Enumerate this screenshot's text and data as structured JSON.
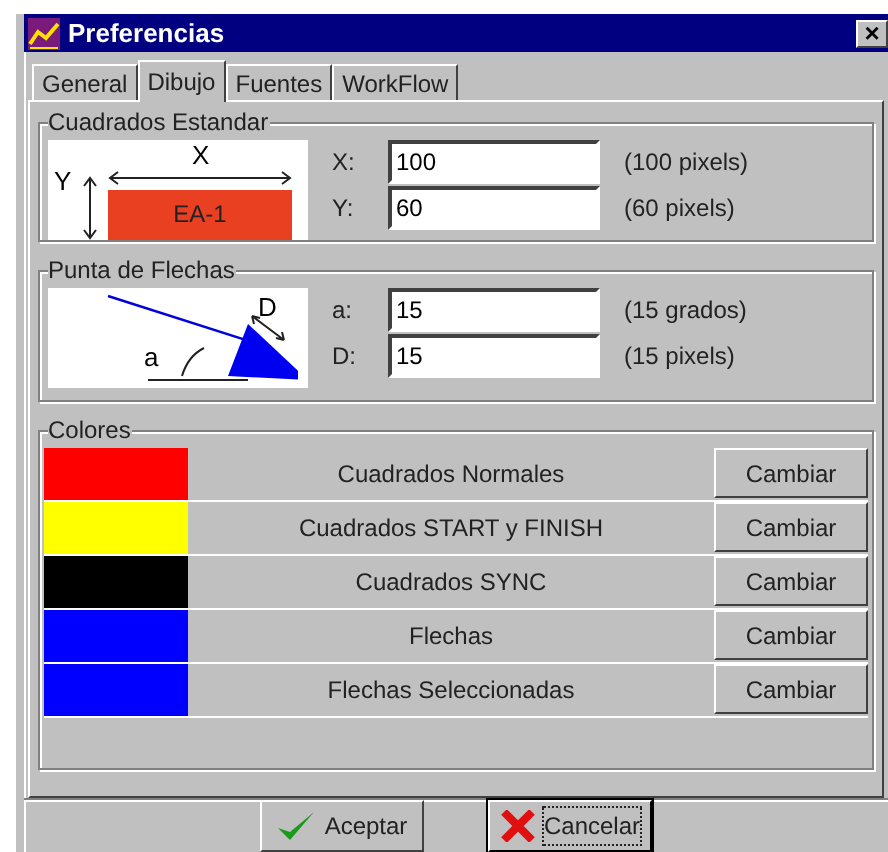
{
  "window": {
    "title": "Preferencias",
    "close": "×"
  },
  "tabs": [
    {
      "label": "General",
      "selected": false
    },
    {
      "label": "Dibujo",
      "selected": true
    },
    {
      "label": "Fuentes",
      "selected": false
    },
    {
      "label": "WorkFlow",
      "selected": false
    }
  ],
  "cuadrados_estandar": {
    "title": "Cuadrados Estandar",
    "width_label": "X",
    "height_label": "Y",
    "box_label": "EA-1",
    "fields": [
      {
        "label": "X:",
        "value": "100",
        "note": "(100 pixels)"
      },
      {
        "label": "Y:",
        "value": "60",
        "note": "(60 pixels)"
      }
    ]
  },
  "punta_de_flechas": {
    "title": "Punta de Flechas",
    "distance_label": "D",
    "angle_label": "a",
    "fields": [
      {
        "label": "a:",
        "value": "15",
        "note": "(15 grados)"
      },
      {
        "label": "D:",
        "value": "15",
        "note": "(15 pixels)"
      }
    ]
  },
  "colores": {
    "title": "Colores",
    "rows": [
      {
        "color": "#ff0000",
        "label": "Cuadrados Normales",
        "button": "Cambiar"
      },
      {
        "color": "#ffff00",
        "label": "Cuadrados START y FINISH",
        "button": "Cambiar"
      },
      {
        "color": "#000000",
        "label": "Cuadrados SYNC",
        "button": "Cambiar"
      },
      {
        "color": "#0000ff",
        "label": "Flechas",
        "button": "Cambiar"
      },
      {
        "color": "#0000ff",
        "label": "Flechas Seleccionadas",
        "button": "Cambiar"
      }
    ]
  },
  "buttons": [
    {
      "label": "Aceptar",
      "kind": "ok",
      "focused": false
    },
    {
      "label": "Cancelar",
      "kind": "cancel",
      "focused": true
    }
  ]
}
